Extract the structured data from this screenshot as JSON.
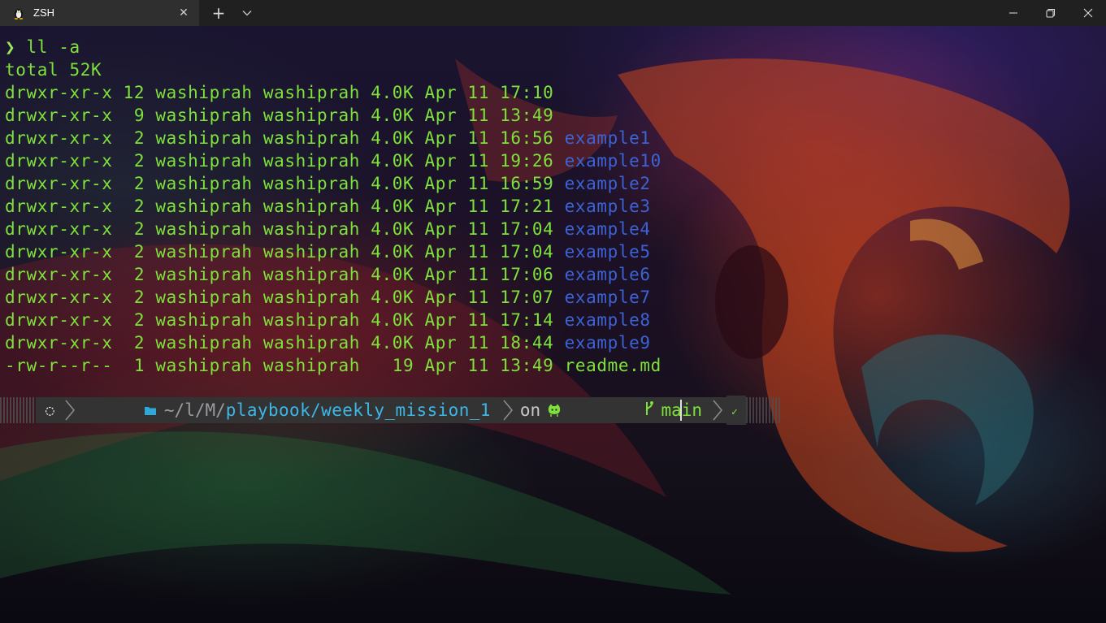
{
  "window": {
    "tab_title": "ZSH",
    "tab_icon": "linux-tux-icon",
    "close_tab_glyph": "✕",
    "new_tab_glyph": "+",
    "controls": [
      "minimize-icon",
      "restore-icon",
      "close-icon"
    ]
  },
  "colors": {
    "green": "#7ee23a",
    "dir_blue": "#3c63d6",
    "path_blue": "#3db7e8",
    "titlebar": "#202020",
    "tab": "#2f2f2f"
  },
  "terminal": {
    "command_prompt": "❯",
    "command": "ll -a",
    "total": "total 52K",
    "listing": [
      {
        "meta": "drwxr-xr-x 12 washiprah washiprah 4.0K Apr 11 17:10",
        "name": "",
        "kind": "dir"
      },
      {
        "meta": "drwxr-xr-x  9 washiprah washiprah 4.0K Apr 11 13:49",
        "name": "",
        "kind": "dir"
      },
      {
        "meta": "drwxr-xr-x  2 washiprah washiprah 4.0K Apr 11 16:56",
        "name": "example1",
        "kind": "dir"
      },
      {
        "meta": "drwxr-xr-x  2 washiprah washiprah 4.0K Apr 11 19:26",
        "name": "example10",
        "kind": "dir"
      },
      {
        "meta": "drwxr-xr-x  2 washiprah washiprah 4.0K Apr 11 16:59",
        "name": "example2",
        "kind": "dir"
      },
      {
        "meta": "drwxr-xr-x  2 washiprah washiprah 4.0K Apr 11 17:21",
        "name": "example3",
        "kind": "dir"
      },
      {
        "meta": "drwxr-xr-x  2 washiprah washiprah 4.0K Apr 11 17:04",
        "name": "example4",
        "kind": "dir"
      },
      {
        "meta": "drwxr-xr-x  2 washiprah washiprah 4.0K Apr 11 17:04",
        "name": "example5",
        "kind": "dir"
      },
      {
        "meta": "drwxr-xr-x  2 washiprah washiprah 4.0K Apr 11 17:06",
        "name": "example6",
        "kind": "dir"
      },
      {
        "meta": "drwxr-xr-x  2 washiprah washiprah 4.0K Apr 11 17:07",
        "name": "example7",
        "kind": "dir"
      },
      {
        "meta": "drwxr-xr-x  2 washiprah washiprah 4.0K Apr 11 17:14",
        "name": "example8",
        "kind": "dir"
      },
      {
        "meta": "drwxr-xr-x  2 washiprah washiprah 4.0K Apr 11 18:44",
        "name": "example9",
        "kind": "dir"
      },
      {
        "meta": "-rw-r--r--  1 washiprah washiprah   19 Apr 11 13:49",
        "name": "readme.md",
        "kind": "file"
      }
    ]
  },
  "prompt": {
    "os_icon": "ubuntu-icon",
    "os_glyph": "◌",
    "folder_icon": "folder-icon",
    "path_dim": "~/l/M/",
    "path_main": "playbook/weekly_mission_1",
    "on_text": "on",
    "github_icon": "github-icon",
    "branch_icon": "git-branch-icon",
    "branch_glyph": "ᚴ",
    "branch": "main",
    "status": "✓"
  }
}
